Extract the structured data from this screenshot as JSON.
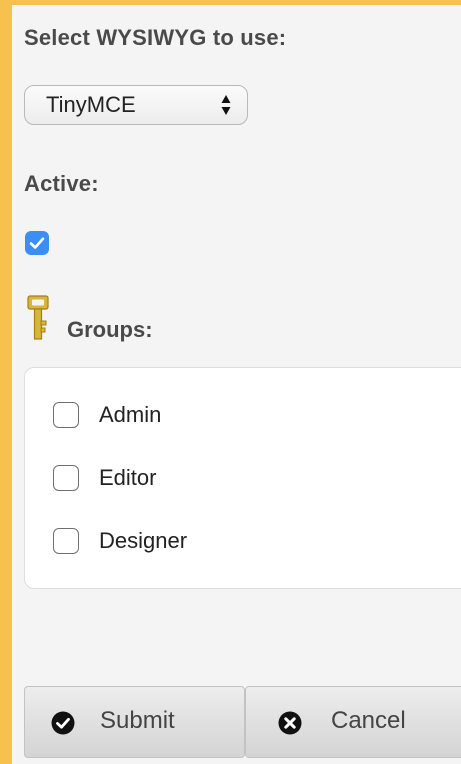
{
  "form": {
    "wysiwyg_label": "Select WYSIWYG to use:",
    "wysiwyg_selected": "TinyMCE",
    "active_label": "Active:",
    "active_checked": true,
    "groups_label": "Groups:",
    "groups": [
      {
        "label": "Admin",
        "checked": false
      },
      {
        "label": "Editor",
        "checked": false
      },
      {
        "label": "Designer",
        "checked": false
      }
    ]
  },
  "buttons": {
    "submit_label": "Submit",
    "cancel_label": "Cancel"
  },
  "colors": {
    "frame": "#f6c14f",
    "panel": "#f4f4f4",
    "checkbox_accent": "#3a8ef6",
    "key_icon": "#d9b53b"
  },
  "icons": {
    "groups": "key-icon",
    "submit": "check-circle-icon",
    "cancel": "close-circle-icon",
    "select": "select-arrows-icon"
  }
}
